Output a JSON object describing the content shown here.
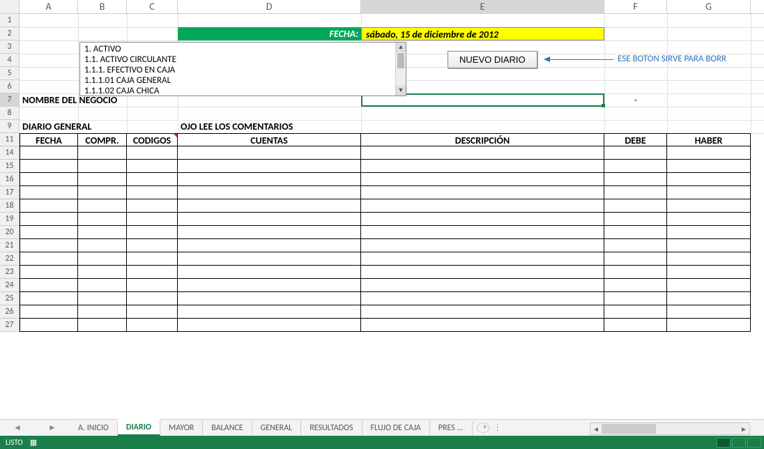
{
  "columns": [
    "A",
    "B",
    "C",
    "D",
    "E",
    "F",
    "G"
  ],
  "row_numbers": [
    1,
    2,
    3,
    4,
    5,
    6,
    7,
    8,
    9,
    11,
    14,
    15,
    16,
    17,
    18,
    19,
    20,
    21,
    22,
    23,
    24,
    25,
    26,
    27
  ],
  "row2": {
    "fecha_label": "FECHA:",
    "fecha_value": "sábado, 15 de diciembre de 2012"
  },
  "dropdown": {
    "items": [
      "1. ACTIVO",
      "1.1. ACTIVO CIRCULANTE",
      "1.1.1. EFECTIVO EN CAJA",
      "1.1.1.01 CAJA GENERAL",
      "1.1.1.02 CAJA CHICA"
    ]
  },
  "button": {
    "label": "NUEVO DIARIO"
  },
  "callout": {
    "text": "ESE BOTON SIRVE PARA BORR"
  },
  "row7": {
    "label": "NOMBRE DEL NEGOCIO",
    "f": "-"
  },
  "row9": {
    "a": "DIARIO GENERAL",
    "d": "OJO LEE LOS COMENTARIOS"
  },
  "table_headers": {
    "a": "FECHA",
    "b": "COMPR.",
    "c": "CODIGOS",
    "d": "CUENTAS",
    "e": "DESCRIPCIÓN",
    "f": "DEBE",
    "g": "HABER"
  },
  "tabs": [
    "A. INICIO",
    "DIARIO",
    "MAYOR",
    "BALANCE",
    "GENERAL",
    "RESULTADOS",
    "FLUJO DE CAJA",
    "PRES ..."
  ],
  "status": {
    "text": "LISTO"
  }
}
